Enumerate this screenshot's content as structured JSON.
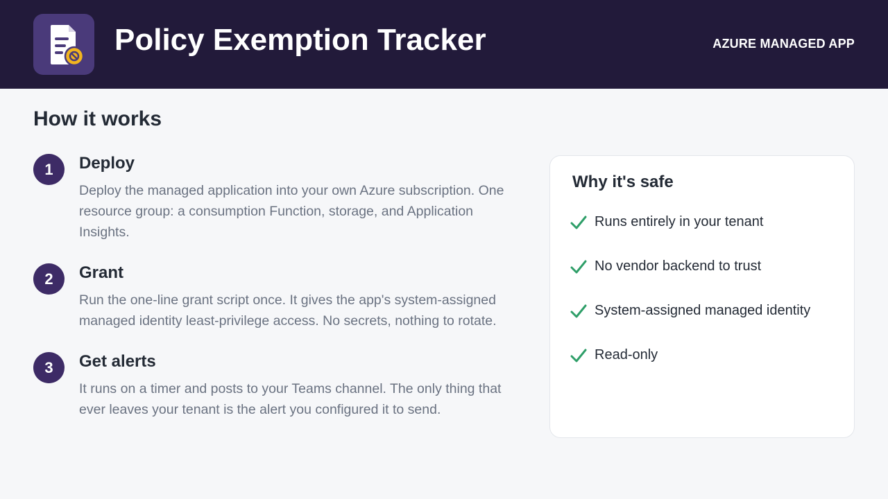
{
  "header": {
    "logo_icon": "document-blocked-icon",
    "title": "Policy Exemption Tracker",
    "tag": "AZURE MANAGED APP"
  },
  "how_it_works": {
    "title": "How it works",
    "steps": [
      {
        "number": "1",
        "title": "Deploy",
        "description": "Deploy the managed application into your own Azure subscription. One resource group: a consumption Function, storage, and Application Insights."
      },
      {
        "number": "2",
        "title": "Grant",
        "description": "Run the one-line grant script once. It gives the app's system-assigned managed identity least-privilege access. No secrets, nothing to rotate."
      },
      {
        "number": "3",
        "title": "Get alerts",
        "description": "It runs on a timer and posts to your Teams channel. The only thing that ever leaves your tenant is the alert you configured it to send."
      }
    ]
  },
  "safety": {
    "title": "Why it's safe",
    "check_icon": "check-icon",
    "items": [
      "Runs entirely in your tenant",
      "No vendor backend to trust",
      "System-assigned managed identity",
      "Read-only"
    ]
  },
  "colors": {
    "header_bg": "#221a3a",
    "accent": "#3d2b66",
    "check": "#2e9e68",
    "badge": "#f2b51f"
  }
}
